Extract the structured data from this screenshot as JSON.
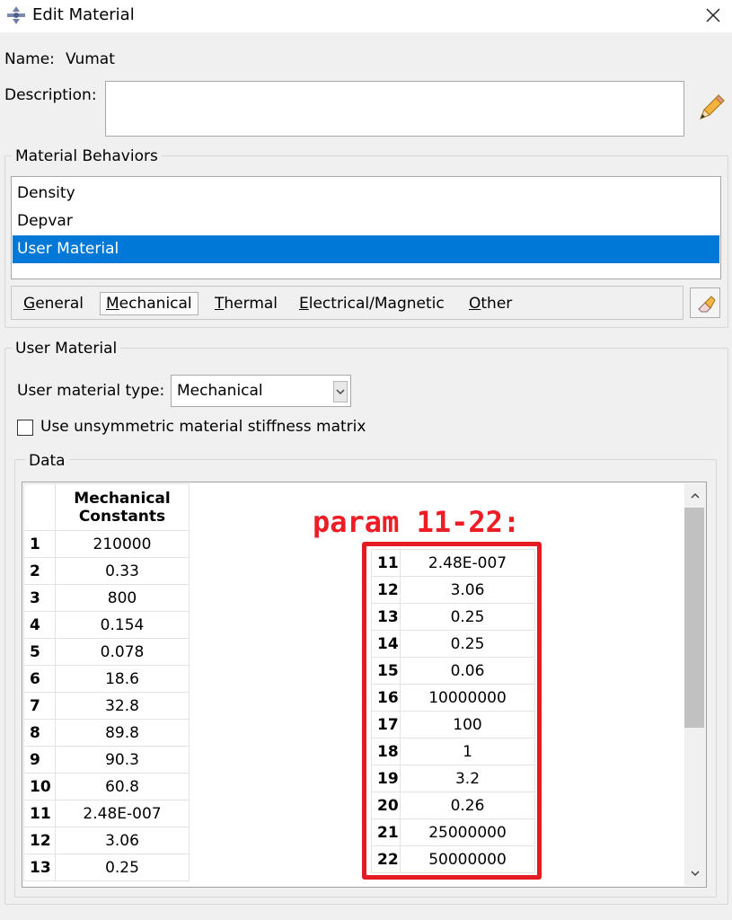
{
  "window": {
    "title": "Edit Material"
  },
  "name": {
    "label": "Name:",
    "value": "Vumat"
  },
  "description": {
    "label": "Description:",
    "value": ""
  },
  "material_behaviors": {
    "title": "Material Behaviors",
    "items": [
      "Density",
      "Depvar",
      "User Material"
    ],
    "selected": "User Material",
    "selected_color": "#0078d7"
  },
  "menu": {
    "general": {
      "mnemonic": "G",
      "rest": "eneral"
    },
    "mechanical": {
      "mnemonic": "M",
      "rest": "echanical"
    },
    "thermal": {
      "mnemonic": "T",
      "rest": "hermal"
    },
    "electrical": {
      "mnemonic": "E",
      "rest": "lectrical/Magnetic"
    },
    "other": {
      "mnemonic": "O",
      "rest": "ther"
    }
  },
  "user_material": {
    "title": "User Material",
    "type_label": "User material type:",
    "type_value": "Mechanical",
    "unsym_label": "Use unsymmetric material stiffness matrix",
    "unsym_checked": false
  },
  "data": {
    "title": "Data",
    "header_line1": "Mechanical",
    "header_line2": "Constants",
    "rows": [
      {
        "n": "1",
        "v": "210000"
      },
      {
        "n": "2",
        "v": "0.33"
      },
      {
        "n": "3",
        "v": "800"
      },
      {
        "n": "4",
        "v": "0.154"
      },
      {
        "n": "5",
        "v": "0.078"
      },
      {
        "n": "6",
        "v": "18.6"
      },
      {
        "n": "7",
        "v": "32.8"
      },
      {
        "n": "8",
        "v": "89.8"
      },
      {
        "n": "9",
        "v": "90.3"
      },
      {
        "n": "10",
        "v": "60.8"
      },
      {
        "n": "11",
        "v": "2.48E-007"
      },
      {
        "n": "12",
        "v": "3.06"
      },
      {
        "n": "13",
        "v": "0.25"
      }
    ]
  },
  "annotation": {
    "label": "param 11-22:",
    "color": "#ee1c24",
    "rows": [
      {
        "n": "11",
        "v": "2.48E-007"
      },
      {
        "n": "12",
        "v": "3.06"
      },
      {
        "n": "13",
        "v": "0.25"
      },
      {
        "n": "14",
        "v": "0.25"
      },
      {
        "n": "15",
        "v": "0.06"
      },
      {
        "n": "16",
        "v": "10000000"
      },
      {
        "n": "17",
        "v": "100"
      },
      {
        "n": "18",
        "v": "1"
      },
      {
        "n": "19",
        "v": "3.2"
      },
      {
        "n": "20",
        "v": "0.26"
      },
      {
        "n": "21",
        "v": "25000000"
      },
      {
        "n": "22",
        "v": "50000000"
      }
    ]
  }
}
